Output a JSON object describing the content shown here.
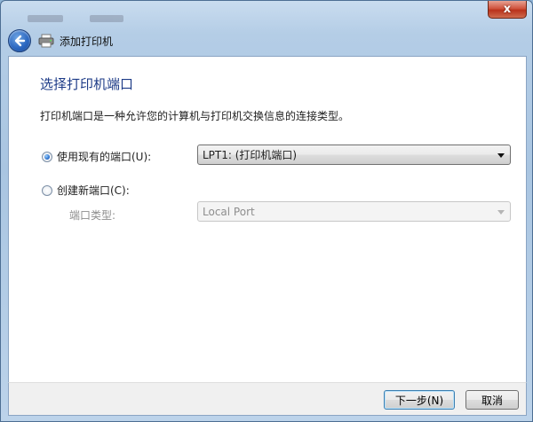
{
  "window": {
    "title": "添加打印机",
    "close_glyph": "x"
  },
  "page": {
    "heading": "选择打印机端口",
    "description": "打印机端口是一种允许您的计算机与打印机交换信息的连接类型。"
  },
  "existing_port": {
    "label": "使用现有的端口(U):",
    "selected": true,
    "value": "LPT1: (打印机端口)"
  },
  "new_port": {
    "label": "创建新端口(C):",
    "selected": false,
    "type_label": "端口类型:",
    "type_value": "Local Port"
  },
  "footer": {
    "next_label": "下一步(N)",
    "cancel_label": "取消"
  },
  "colors": {
    "heading": "#1d3b87",
    "disabled_text": "#8e8e8e"
  }
}
